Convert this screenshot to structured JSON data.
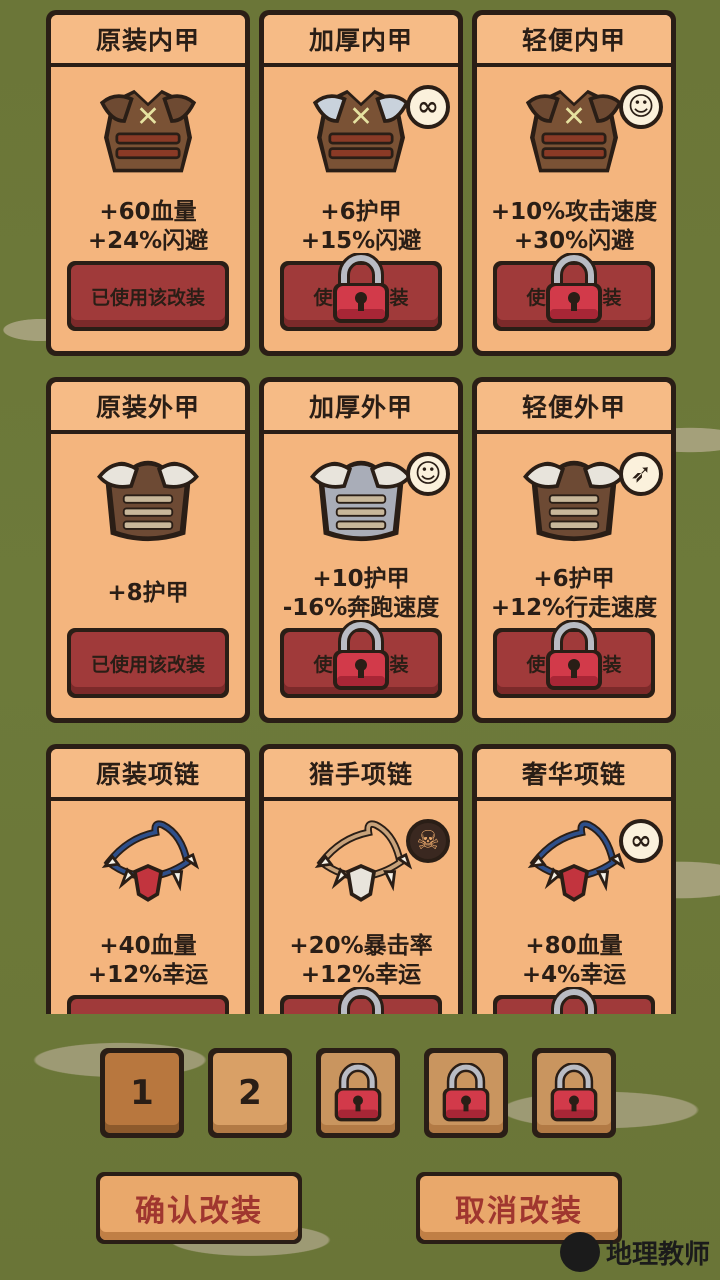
{
  "cards": [
    {
      "title": "原装内甲",
      "stats": [
        "+60血量",
        "+24%闪避"
      ],
      "button": "已使用该改装",
      "locked": false,
      "badge": null,
      "art": "leather-vest"
    },
    {
      "title": "加厚内甲",
      "stats": [
        "+6护甲",
        "+15%闪避"
      ],
      "button": "使用该改装",
      "locked": true,
      "badge": "infinity-icon",
      "art": "armored-vest"
    },
    {
      "title": "轻便内甲",
      "stats": [
        "+10%攻击速度",
        "+30%闪避"
      ],
      "button": "使用该改装",
      "locked": true,
      "badge": "survivor-icon",
      "art": "leather-vest"
    },
    {
      "title": "原装外甲",
      "stats": [
        "+8护甲"
      ],
      "button": "已使用该改装",
      "locked": false,
      "badge": null,
      "art": "fur-armor"
    },
    {
      "title": "加厚外甲",
      "stats": [
        "+10护甲",
        "-16%奔跑速度"
      ],
      "button": "使用该改装",
      "locked": true,
      "badge": "survivor-icon",
      "art": "plate-armor"
    },
    {
      "title": "轻便外甲",
      "stats": [
        "+6护甲",
        "+12%行走速度"
      ],
      "button": "使用该改装",
      "locked": true,
      "badge": "bow-icon",
      "art": "fur-armor"
    },
    {
      "title": "原装项链",
      "stats": [
        "+40血量",
        "+12%幸运"
      ],
      "button": "",
      "locked": false,
      "badge": null,
      "art": "fang-necklace"
    },
    {
      "title": "猎手项链",
      "stats": [
        "+20%暴击率",
        "+12%幸运"
      ],
      "button": "",
      "locked": true,
      "badge": "skull-icon",
      "art": "skull-necklace"
    },
    {
      "title": "奢华项链",
      "stats": [
        "+80血量",
        "+4%幸运"
      ],
      "button": "",
      "locked": true,
      "badge": "infinity-icon",
      "art": "gem-necklace"
    }
  ],
  "tabs": [
    {
      "label": "1",
      "active": true,
      "locked": false
    },
    {
      "label": "2",
      "active": false,
      "locked": false
    },
    {
      "label": "",
      "active": false,
      "locked": true
    },
    {
      "label": "",
      "active": false,
      "locked": true
    },
    {
      "label": "",
      "active": false,
      "locked": true
    }
  ],
  "actions": {
    "confirm": "确认改装",
    "cancel": "取消改装"
  },
  "watermark": "地理教师",
  "colors": {
    "card": "#f4b57e",
    "button": "#a03a3a",
    "outline": "#2a1e16",
    "grass": "#6f7a3a",
    "action_text": "#a0362f"
  }
}
